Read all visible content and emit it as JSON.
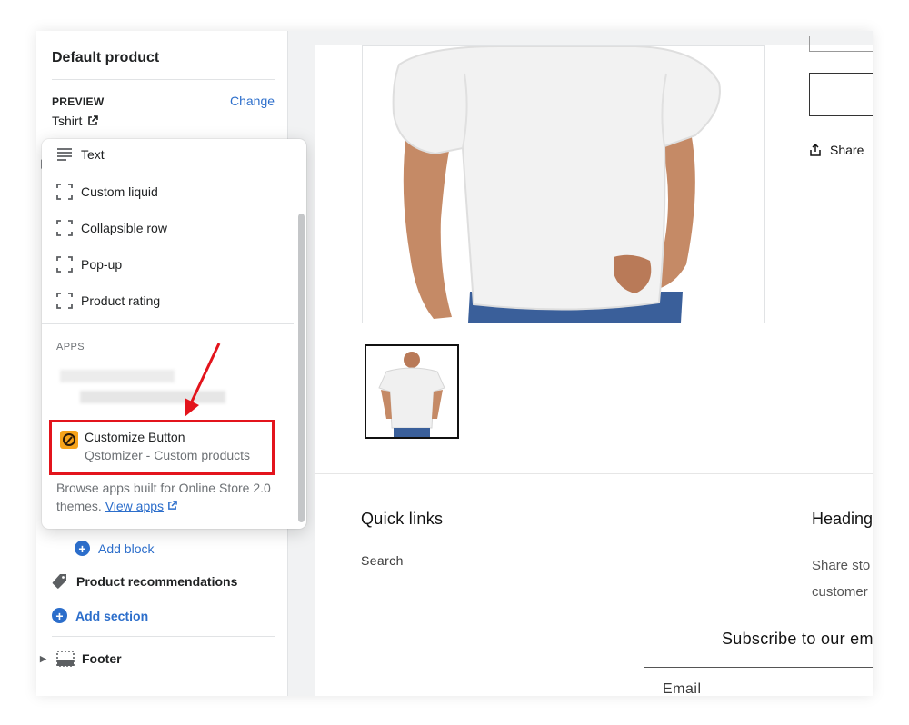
{
  "sidebar": {
    "title": "Default product",
    "preview_label": "PREVIEW",
    "change_label": "Change",
    "preview_value": "Tshirt",
    "add_block": "Add block",
    "product_recommendations": "Product recommendations",
    "add_section": "Add section",
    "footer": "Footer"
  },
  "popover": {
    "items": [
      {
        "label": "Text",
        "icon": "text-lines-icon"
      },
      {
        "label": "Custom liquid",
        "icon": "dashed-square-icon"
      },
      {
        "label": "Collapsible row",
        "icon": "dashed-square-icon"
      },
      {
        "label": "Pop-up",
        "icon": "dashed-square-icon"
      },
      {
        "label": "Product rating",
        "icon": "dashed-square-icon"
      }
    ],
    "apps_label": "APPS",
    "app": {
      "name": "Customize Button",
      "subtitle": "Qstomizer - Custom products"
    },
    "browse_text": "Browse apps built for Online Store 2.0 themes.",
    "view_apps": "View apps"
  },
  "preview": {
    "share": "Share",
    "quick_links": "Quick links",
    "search": "Search",
    "heading": "Heading",
    "share_text_1": "Share sto",
    "share_text_2": "customer",
    "subscribe": "Subscribe to our ema",
    "email_placeholder": "Email"
  },
  "colors": {
    "accent": "#2c6ecb",
    "highlight": "#e3141c",
    "app_icon": "#f6a31b"
  }
}
